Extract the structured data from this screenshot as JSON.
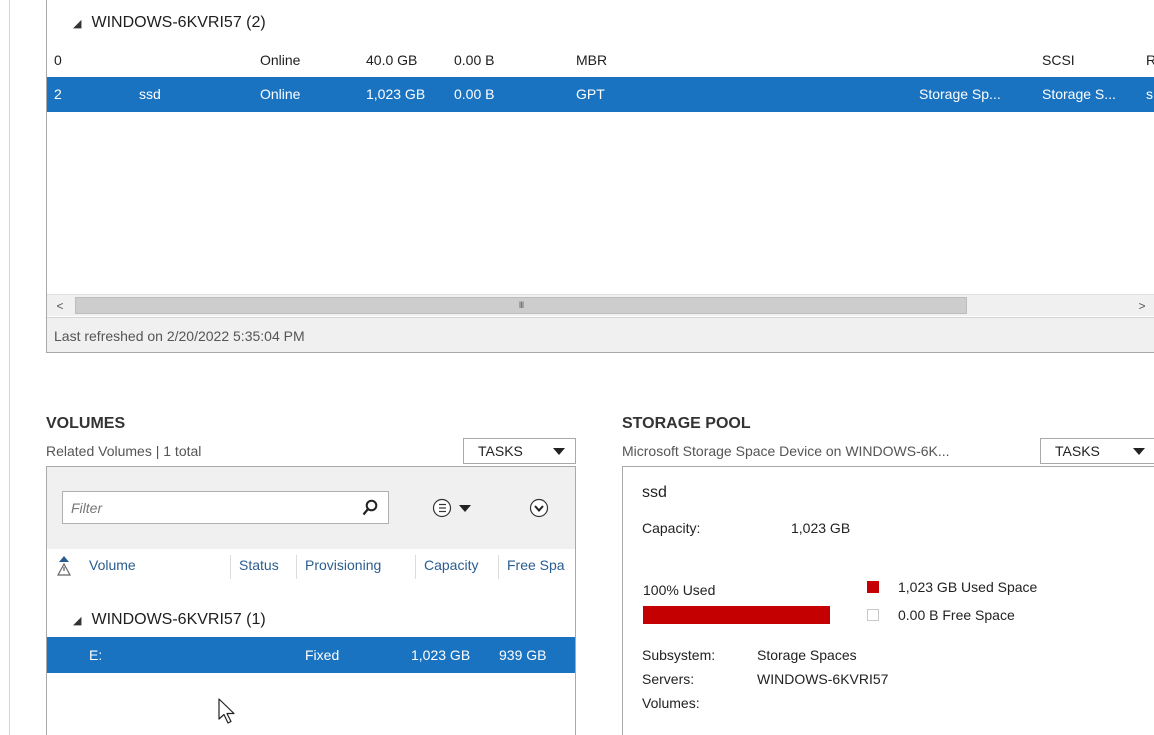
{
  "disks": {
    "group_label": "WINDOWS-6KVRI57 (2)",
    "rows": [
      {
        "number": "0",
        "name": "",
        "status": "Online",
        "capacity": "40.0 GB",
        "unallocated": "0.00 B",
        "partition": "MBR",
        "subsystem": "",
        "bus": "SCSI",
        "extra": "R"
      },
      {
        "number": "2",
        "name": "ssd",
        "status": "Online",
        "capacity": "1,023 GB",
        "unallocated": "0.00 B",
        "partition": "GPT",
        "subsystem": "Storage Sp...",
        "bus": "Storage S...",
        "extra": "s"
      }
    ],
    "scroll_grip": "III",
    "last_refreshed": "Last refreshed on 2/20/2022 5:35:04 PM"
  },
  "volumes": {
    "title": "VOLUMES",
    "subtitle": "Related Volumes | 1 total",
    "tasks_label": "TASKS",
    "filter_placeholder": "Filter",
    "columns": [
      "Volume",
      "Status",
      "Provisioning",
      "Capacity",
      "Free Spa"
    ],
    "group_label": "WINDOWS-6KVRI57 (1)",
    "rows": [
      {
        "volume": "E:",
        "status": "",
        "provisioning": "Fixed",
        "capacity": "1,023 GB",
        "free_space": "939 GB"
      }
    ]
  },
  "storage_pool": {
    "title": "STORAGE POOL",
    "subtitle": "Microsoft Storage Space Device on WINDOWS-6K...",
    "tasks_label": "TASKS",
    "name": "ssd",
    "capacity_label": "Capacity:",
    "capacity_value": "1,023 GB",
    "used_percent_label": "100% Used",
    "used_fraction": 1.0,
    "legend_used": "1,023 GB Used Space",
    "legend_free": "0.00 B Free Space",
    "used_color": "#c40000",
    "subsystem_label": "Subsystem:",
    "subsystem_value": "Storage Spaces",
    "servers_label": "Servers:",
    "servers_value": "WINDOWS-6KVRI57",
    "volumes_label": "Volumes:"
  },
  "colors": {
    "selection": "#1a73c0",
    "panel_border": "#a9a9a9",
    "header_text": "#2a5d8f"
  }
}
